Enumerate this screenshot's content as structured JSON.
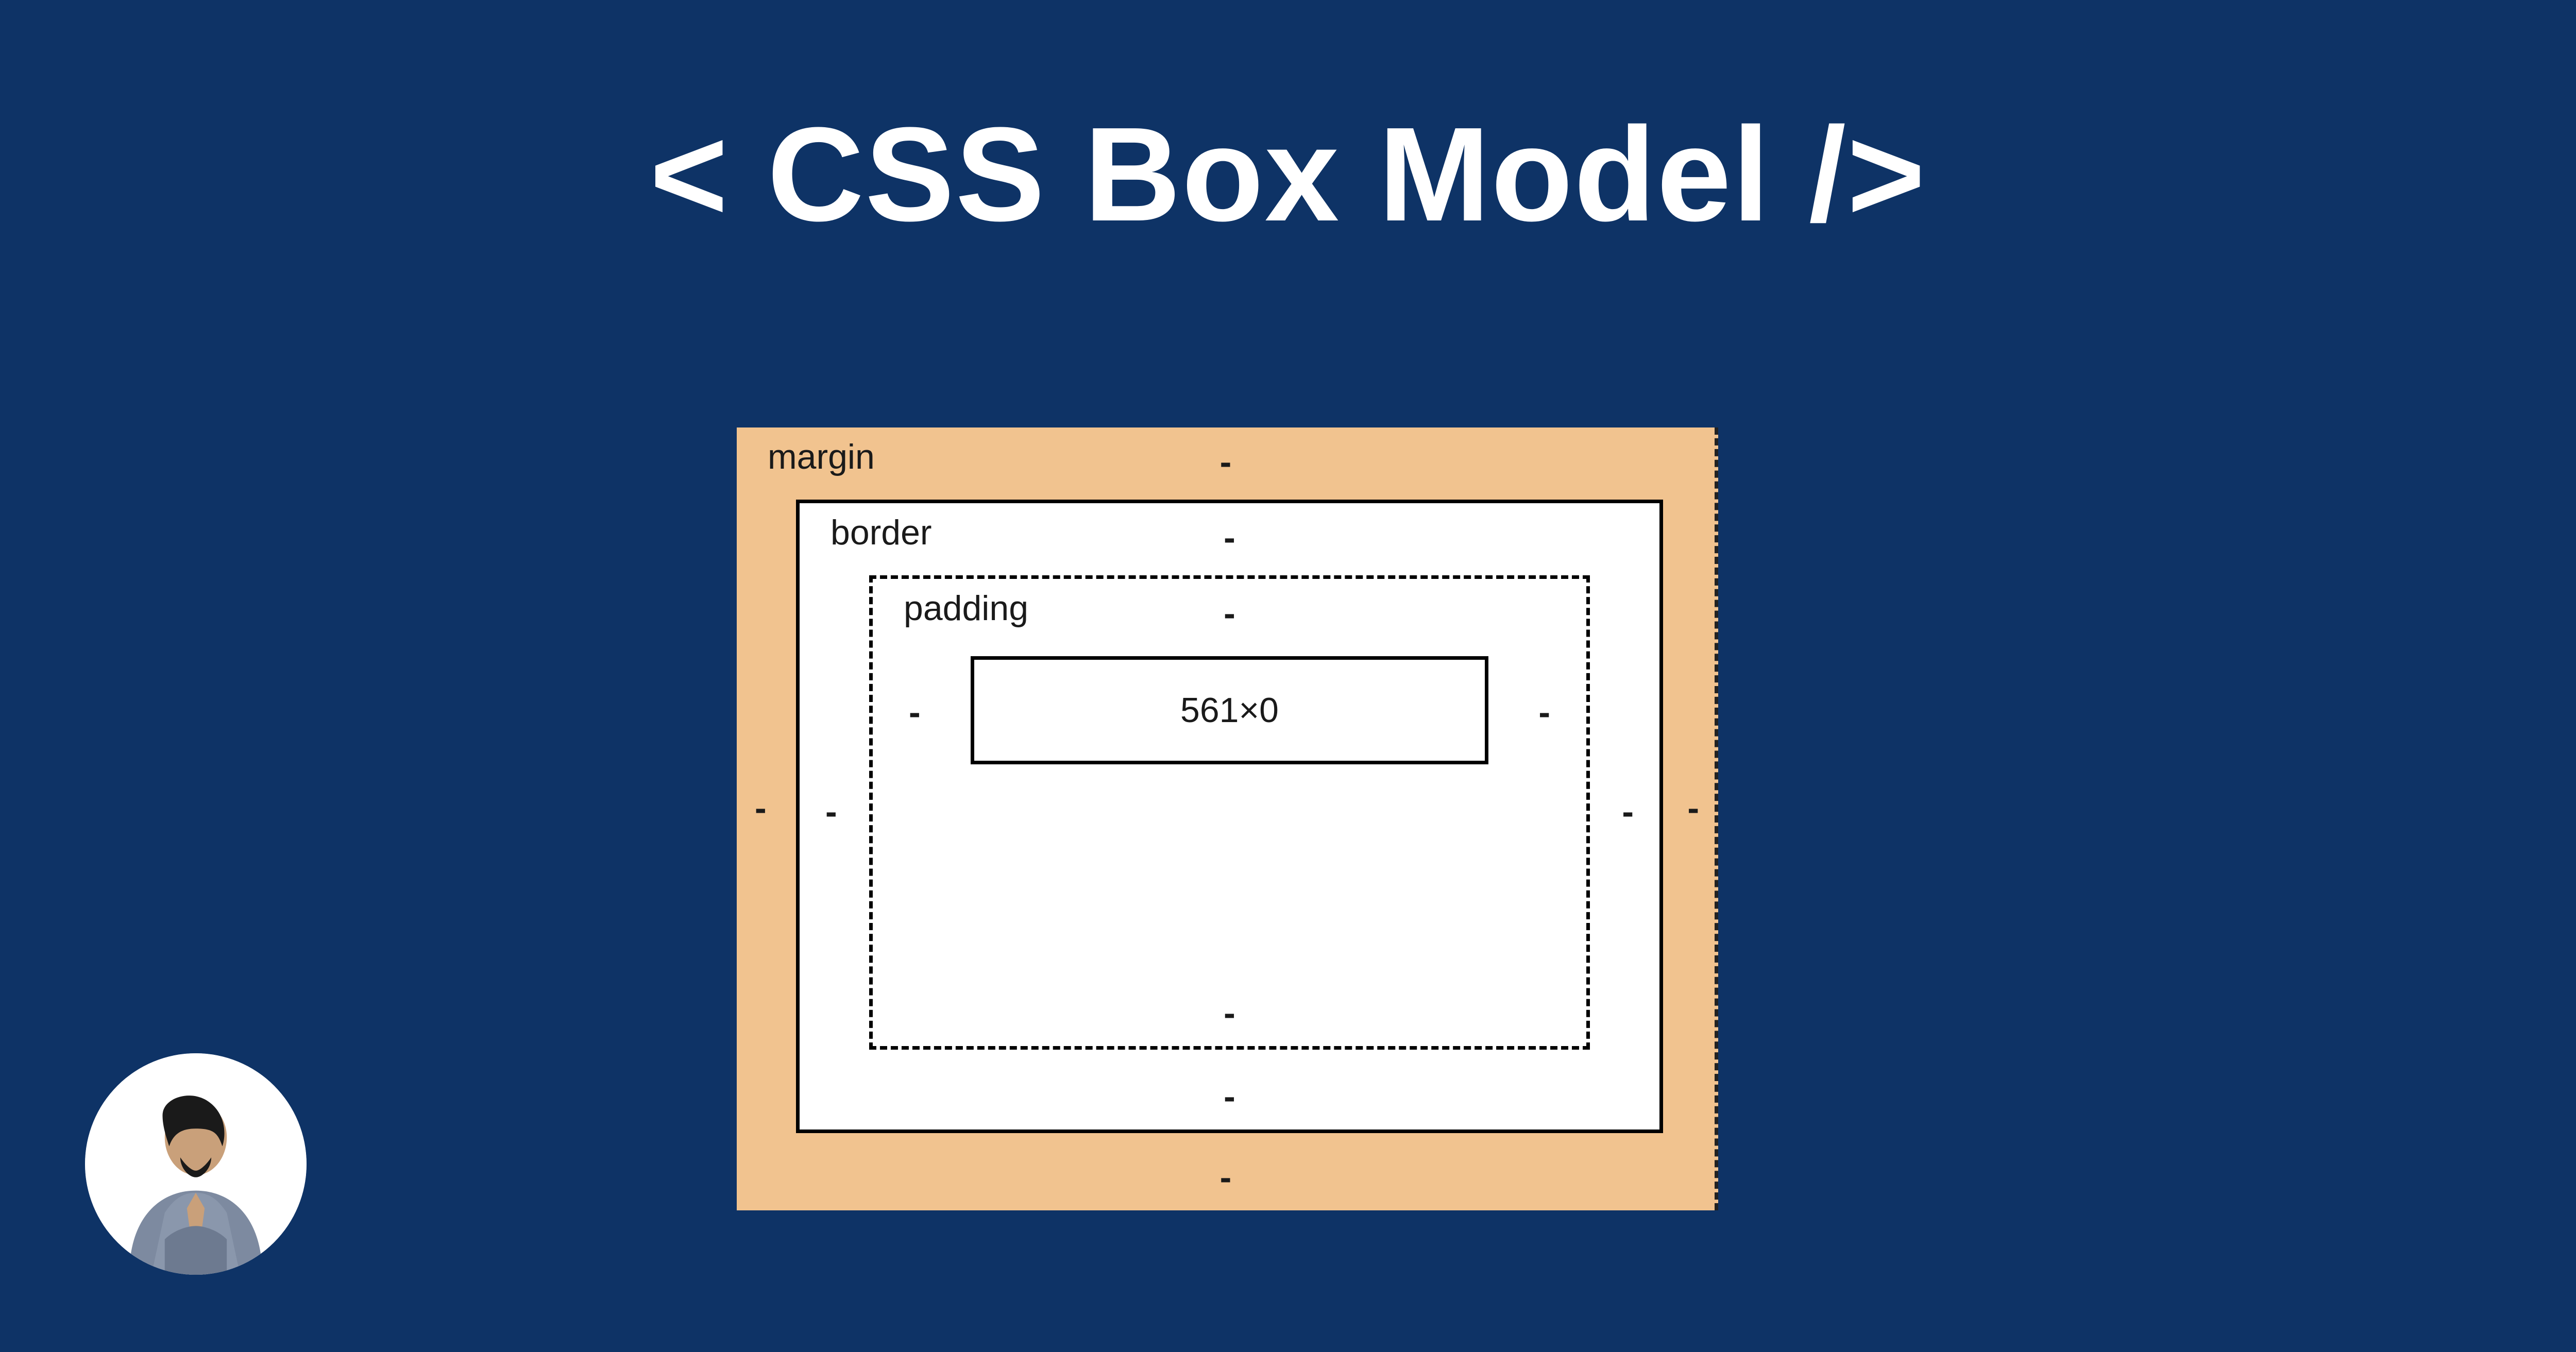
{
  "title": "< CSS Box Model />",
  "box": {
    "margin": {
      "label": "margin",
      "top": "-",
      "right": "-",
      "bottom": "-",
      "left": "-"
    },
    "border": {
      "label": "border",
      "top": "-",
      "right": "-",
      "bottom": "-",
      "left": "-"
    },
    "padding": {
      "label": "padding",
      "top": "-",
      "right": "-",
      "bottom": "-",
      "left": "-"
    },
    "content": {
      "dimensions": "561×0"
    }
  }
}
